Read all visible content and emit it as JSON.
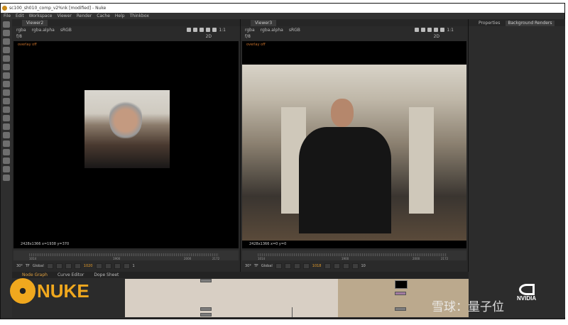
{
  "window": {
    "title": "sc100_sh010_comp_v2%nk [modified] - Nuke"
  },
  "menu": [
    "File",
    "Edit",
    "Workspace",
    "Viewer",
    "Render",
    "Cache",
    "Help",
    "Thinkbox"
  ],
  "viewers": [
    {
      "tab": "Viewer2",
      "channels": "rgba",
      "alpha": "rgba.alpha",
      "colorspace": "sRGB",
      "zoom": "1:1",
      "mode": "2D",
      "frame_in": "f/8",
      "overlay": "overlay off",
      "info": "2428x1366   x=1938 y=370",
      "tl_start": "1014",
      "tl_mid": "1900",
      "tl_2000": "2000",
      "tl_end": "2172",
      "current_frame": "1020",
      "fps": "30*",
      "tf": "TF",
      "scope": "Global",
      "step": "1"
    },
    {
      "tab": "Viewer3",
      "channels": "rgba",
      "alpha": "rgba.alpha",
      "colorspace": "sRGB",
      "zoom": "1:1",
      "mode": "2D",
      "frame_in": "f/8",
      "overlay": "overlay off",
      "info": "2428x1366   x=0 y=0",
      "tl_start": "1014",
      "tl_mid": "1900",
      "tl_2000": "2000",
      "tl_end": "2172",
      "current_frame": "1018",
      "fps": "30*",
      "tf": "TF",
      "scope": "Global",
      "step": "10"
    }
  ],
  "properties": {
    "tabs": [
      "Properties",
      "Background Renders"
    ]
  },
  "node_graph": {
    "tabs": [
      "Node Graph",
      "Curve Editor",
      "Dope Sheet"
    ]
  },
  "logo": "NUKE",
  "watermark": "雪球：量子位",
  "nvidia": "NVIDIA",
  "colors": {
    "accent": "#f0a81e",
    "panel": "#2b2b2b",
    "frame": "#e09a2a"
  }
}
